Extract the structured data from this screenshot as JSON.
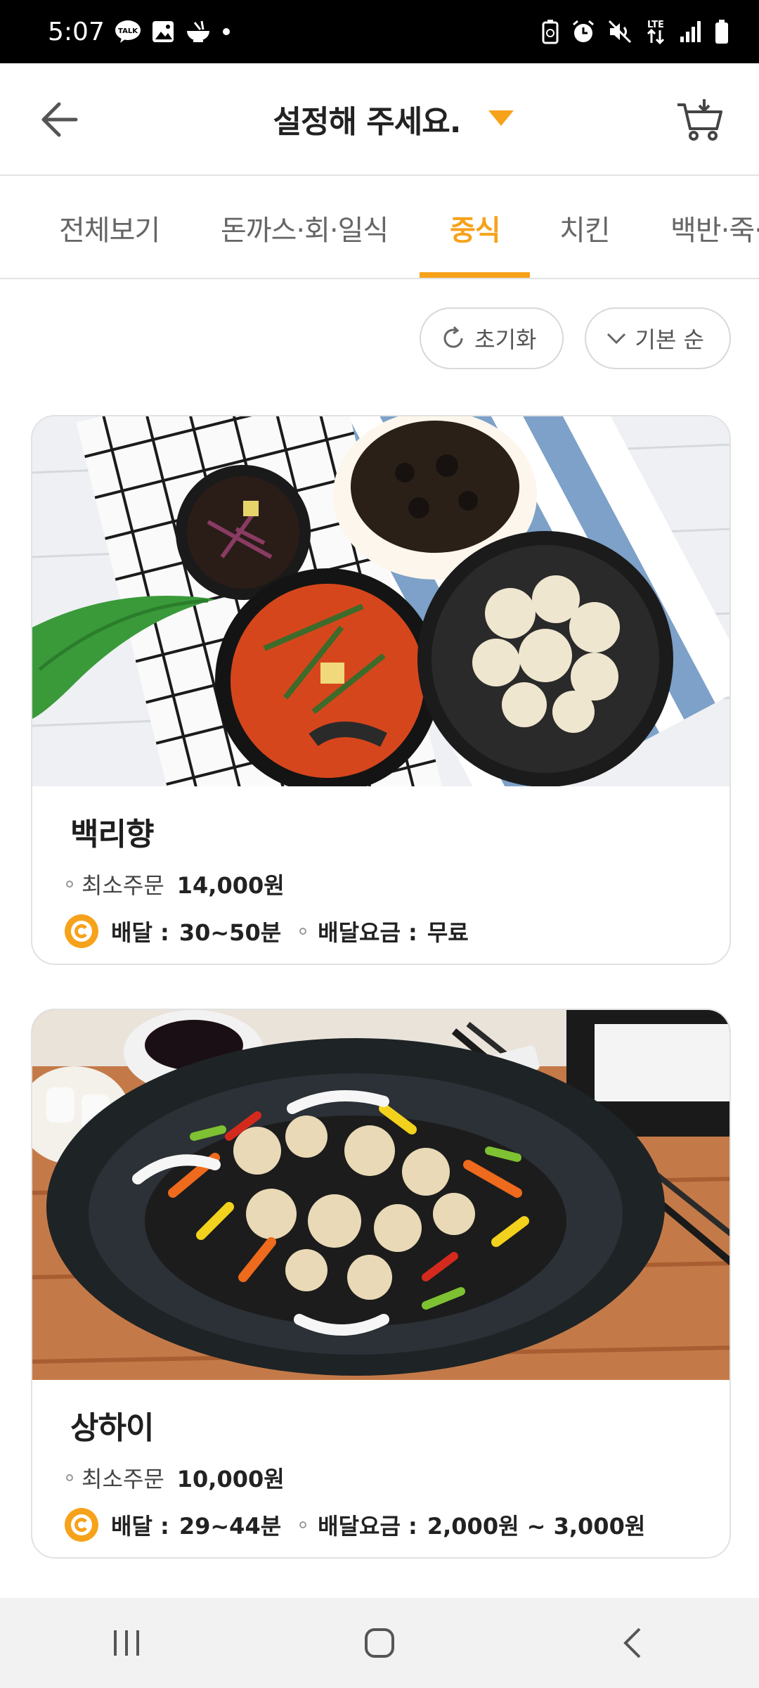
{
  "status_bar": {
    "time": "5:07"
  },
  "header": {
    "title": "설정해 주세요."
  },
  "tabs": [
    {
      "label": "전체보기"
    },
    {
      "label": "돈까스·회·일식"
    },
    {
      "label": "중식"
    },
    {
      "label": "치킨"
    },
    {
      "label": "백반·죽·"
    }
  ],
  "active_tab": "중식",
  "filters": {
    "reset_label": "초기화",
    "sort_label": "기본 순"
  },
  "stores": [
    {
      "name": "백리향",
      "min_order_label": "최소주문",
      "min_order": "14,000원",
      "delivery_label": "배달 :",
      "delivery_time": "30~50분",
      "fee_label": "배달요금 :",
      "fee": "무료"
    },
    {
      "name": "상하이",
      "min_order_label": "최소주문",
      "min_order": "10,000원",
      "delivery_label": "배달 :",
      "delivery_time": "29~44분",
      "fee_label": "배달요금 :",
      "fee": "2,000원 ~ 3,000원"
    }
  ],
  "colors": {
    "accent": "#f7a21b",
    "text": "#1f1f1f",
    "border": "#e2e2e2"
  }
}
